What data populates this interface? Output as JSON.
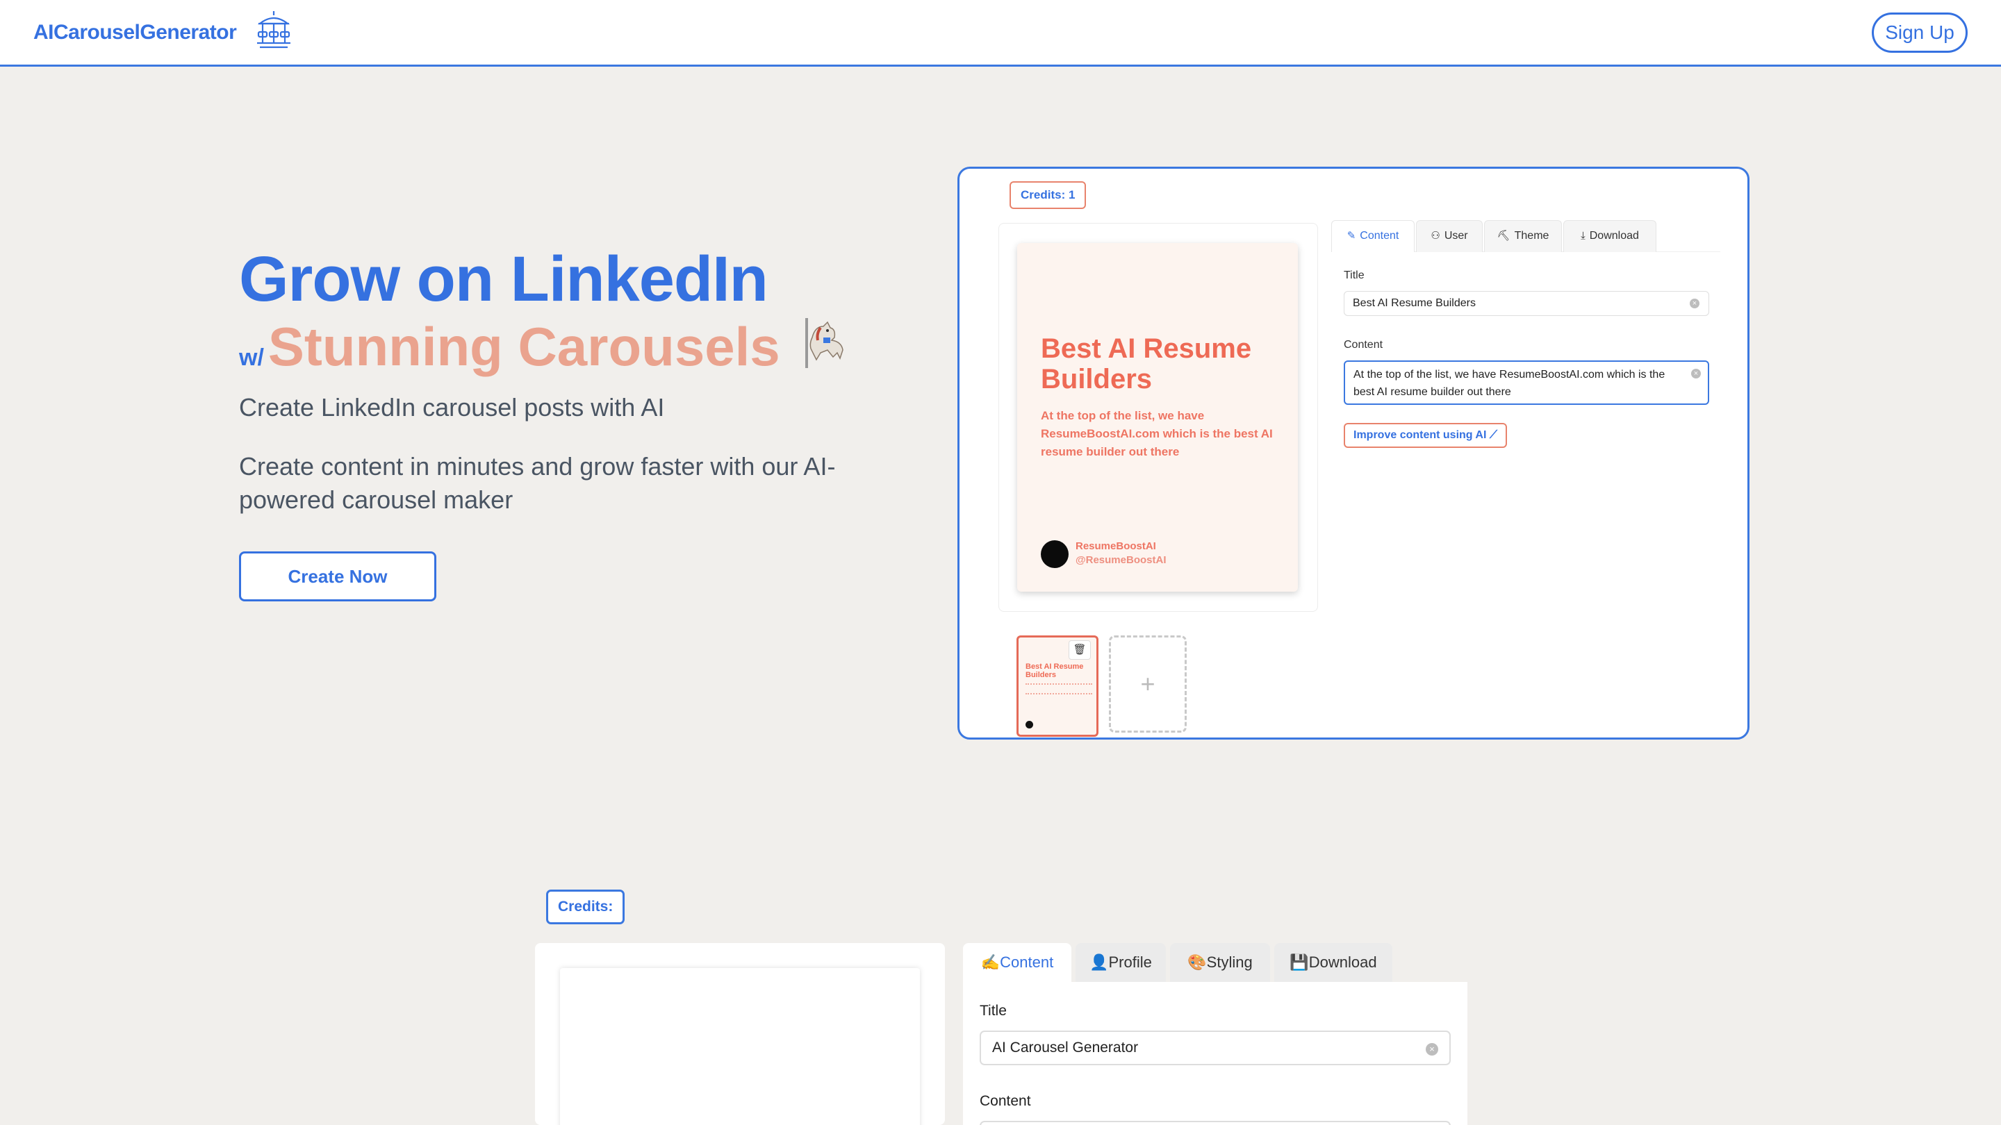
{
  "header": {
    "logo": "AICarouselGenerator",
    "signup_label": "Sign Up"
  },
  "hero": {
    "title": "Grow on LinkedIn",
    "w_prefix": "w/",
    "subtitle": "Stunning Carousels",
    "line1": "Create LinkedIn carousel posts with AI",
    "line2": "Create content in minutes and grow faster with our AI-powered carousel maker",
    "cta_label": "Create Now"
  },
  "demo": {
    "credits": "Credits: 1",
    "tabs": [
      {
        "label": "Content",
        "icon": "pencil-icon"
      },
      {
        "label": "User",
        "icon": "user-icon"
      },
      {
        "label": "Theme",
        "icon": "paint-icon"
      },
      {
        "label": "Download",
        "icon": "download-icon"
      }
    ],
    "title_label": "Title",
    "title_value": "Best AI Resume Builders",
    "content_label": "Content",
    "content_value": "At the top of the list, we have ResumeBoostAI.com which is the best AI resume builder out there",
    "improve_label": "Improve content using AI ⟋",
    "slide": {
      "title": "Best AI Resume Builders",
      "content": "At the top of the list, we have ResumeBoostAI.com which is the best AI resume builder out there",
      "author_name": "ResumeBoostAI",
      "author_handle": "@ResumeBoostAI"
    },
    "thumb_title": "Best AI Resume Builders",
    "add_label": "+"
  },
  "app": {
    "credits": "Credits:",
    "tabs": [
      {
        "label": "✍️Content"
      },
      {
        "label": "👤Profile"
      },
      {
        "label": "🎨Styling"
      },
      {
        "label": "💾Download"
      }
    ],
    "title_label": "Title",
    "title_value": "AI Carousel Generator",
    "content_label": "Content"
  },
  "colors": {
    "primary": "#3571e0",
    "accent": "#eaa38e",
    "slide_text": "#ee6a55",
    "background": "#f1efec"
  }
}
